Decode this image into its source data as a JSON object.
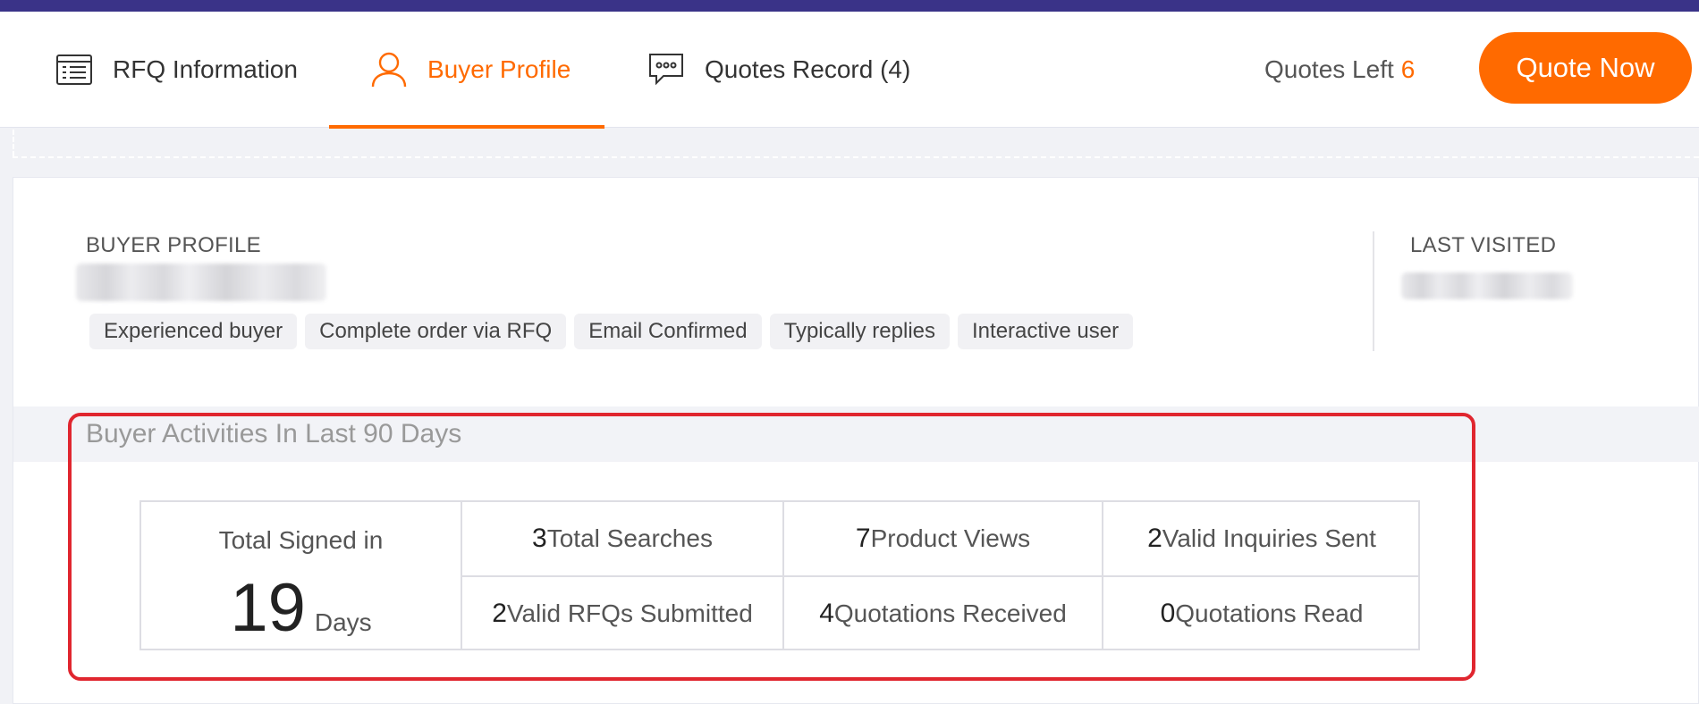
{
  "tabs": {
    "rfq_info": {
      "label": "RFQ Information",
      "icon": "list-document-icon"
    },
    "buyer_profile": {
      "label": "Buyer Profile",
      "icon": "user-icon",
      "active": true
    },
    "quotes_record": {
      "label": "Quotes Record (4)",
      "icon": "chat-bubble-icon"
    }
  },
  "header": {
    "quotes_left_label": "Quotes Left",
    "quotes_left_value": "6",
    "quote_button_label": "Quote Now"
  },
  "profile": {
    "section_label": "BUYER PROFILE",
    "tags": [
      "Experienced buyer",
      "Complete order via RFQ",
      "Email Confirmed",
      "Typically replies",
      "Interactive user"
    ],
    "last_visited_label": "LAST VISITED"
  },
  "activities": {
    "title": "Buyer Activities In Last 90 Days",
    "total_signed_in": {
      "label": "Total Signed in",
      "value": "19",
      "unit": "Days"
    },
    "stats": [
      {
        "value": "3",
        "label": "Total Searches"
      },
      {
        "value": "7",
        "label": "Product Views"
      },
      {
        "value": "2",
        "label": "Valid Inquiries Sent"
      },
      {
        "value": "2",
        "label": "Valid RFQs Submitted"
      },
      {
        "value": "4",
        "label": "Quotations Received"
      },
      {
        "value": "0",
        "label": "Quotations Read"
      }
    ]
  },
  "colors": {
    "accent": "#ff6a00",
    "top_strip": "#3a3388",
    "highlight_border": "#e0262f"
  }
}
